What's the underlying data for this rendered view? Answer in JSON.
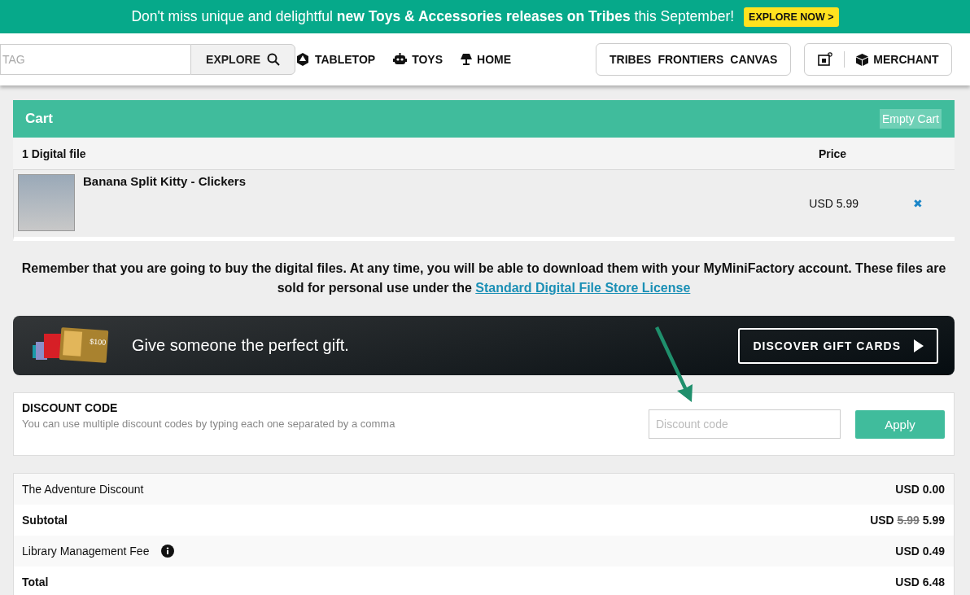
{
  "banner": {
    "text": "Don't miss unique and delightful **new Toys & Accessories releases on Tribes** this September!",
    "button": "EXPLORE NOW >"
  },
  "nav": {
    "search": {
      "placeholder": "TAG"
    },
    "explore": "EXPLORE",
    "categories": [
      "TABLETOP",
      "TOYS",
      "HOME"
    ],
    "tribes": [
      "TRIBES",
      "FRONTIERS",
      "CANVAS"
    ],
    "merchant": "MERCHANT"
  },
  "cart": {
    "title": "Cart",
    "empty_button": "Empty Cart",
    "columns": [
      "1 Digital file",
      "Price"
    ],
    "items": [
      {
        "name": "Banana Split Kitty - Clickers",
        "price": "USD 5.99",
        "remove": "✖"
      }
    ]
  },
  "note": {
    "text": "Remember that you are going to buy the digital files. At any time, you will be able to download them with your MyMiniFactory account. These files are sold for personal use under the",
    "link": "Standard Digital File Store License"
  },
  "gift": {
    "text": "Give someone the perfect gift.",
    "button": "DISCOVER GIFT CARDS",
    "card_value": "$100"
  },
  "discount": {
    "title": "DISCOUNT CODE",
    "help": "You can use multiple discount codes by typing each one separated by a comma",
    "placeholder": "Discount code",
    "button": "Apply"
  },
  "summary": [
    {
      "kind": "plain",
      "label": "The Adventure Discount",
      "amount": "USD 0.00"
    },
    {
      "kind": "struck",
      "label": "Subtotal",
      "currency": "USD",
      "was": "5.99",
      "amount": "5.99"
    },
    {
      "kind": "info",
      "label": "Library Management Fee",
      "amount": "USD 0.49"
    },
    {
      "kind": "total",
      "label": "Total",
      "amount": "USD 6.48"
    }
  ]
}
